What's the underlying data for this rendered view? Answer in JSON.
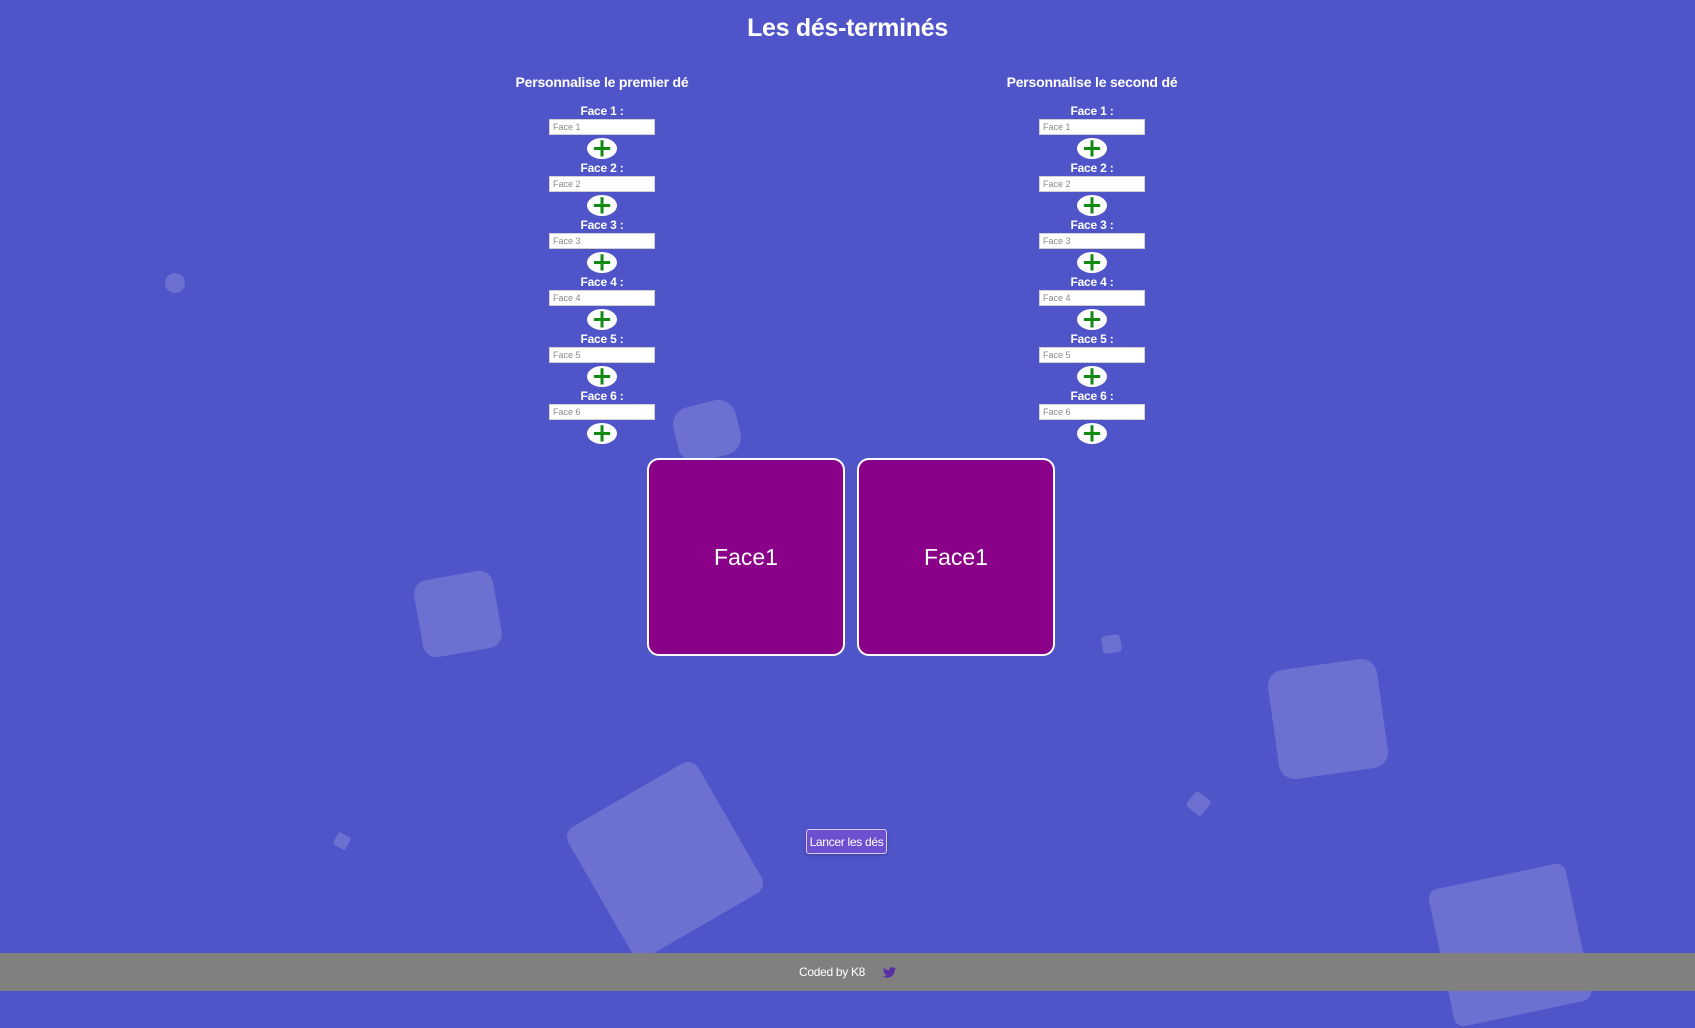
{
  "app": {
    "title": "Les dés-terminés"
  },
  "panels": [
    {
      "title": "Personnalise le premier dé",
      "faces": [
        {
          "label": "Face 1 :",
          "placeholder": "Face 1",
          "value": ""
        },
        {
          "label": "Face 2 :",
          "placeholder": "Face 2",
          "value": ""
        },
        {
          "label": "Face 3 :",
          "placeholder": "Face 3",
          "value": ""
        },
        {
          "label": "Face 4 :",
          "placeholder": "Face 4",
          "value": ""
        },
        {
          "label": "Face 5 :",
          "placeholder": "Face 5",
          "value": ""
        },
        {
          "label": "Face 6 :",
          "placeholder": "Face 6",
          "value": ""
        }
      ],
      "add_icon": "plus-icon"
    },
    {
      "title": "Personnalise le second dé",
      "faces": [
        {
          "label": "Face 1 :",
          "placeholder": "Face 1",
          "value": ""
        },
        {
          "label": "Face 2 :",
          "placeholder": "Face 2",
          "value": ""
        },
        {
          "label": "Face 3 :",
          "placeholder": "Face 3",
          "value": ""
        },
        {
          "label": "Face 4 :",
          "placeholder": "Face 4",
          "value": ""
        },
        {
          "label": "Face 5 :",
          "placeholder": "Face 5",
          "value": ""
        },
        {
          "label": "Face 6 :",
          "placeholder": "Face 6",
          "value": ""
        }
      ],
      "add_icon": "plus-icon"
    }
  ],
  "dice": [
    {
      "face": "Face1"
    },
    {
      "face": "Face1"
    }
  ],
  "roll_button": {
    "label": "Lancer les dés"
  },
  "footer": {
    "credit": "Coded by K8",
    "icon": "twitter-icon"
  },
  "colors": {
    "background": "#4f55c9",
    "die": "#8b0088",
    "plus": "#138a13",
    "button": "#6e4fd0",
    "footer": "#808080",
    "twitter_icon": "#5b2ea8"
  }
}
